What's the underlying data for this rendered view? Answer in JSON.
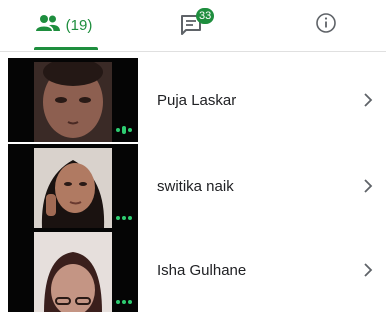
{
  "tabs": {
    "people_count": "(19)",
    "chat_badge": "33"
  },
  "colors": {
    "accent": "#1e8e3e",
    "speaking_indicator": "#2ecc71"
  },
  "participants": [
    {
      "name": "Puja Laskar",
      "indicator": "speaking"
    },
    {
      "name": "switika naik",
      "indicator": "muted"
    },
    {
      "name": "Isha Gulhane",
      "indicator": "muted"
    }
  ]
}
